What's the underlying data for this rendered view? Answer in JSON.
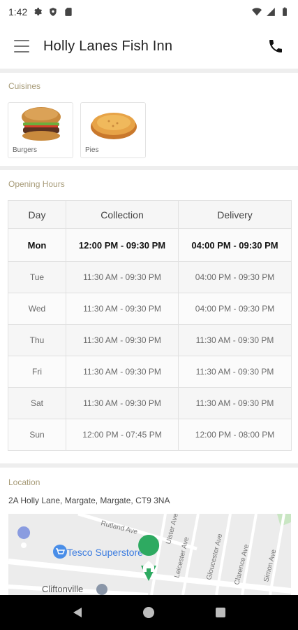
{
  "status_bar": {
    "time": "1:42",
    "icons": [
      "gear-icon",
      "shield-icon",
      "sd-card-icon",
      "wifi-icon",
      "signal-icon",
      "battery-icon"
    ]
  },
  "app_bar": {
    "title": "Holly Lanes Fish Inn",
    "menu_icon": "hamburger-menu-icon",
    "call_icon": "phone-icon"
  },
  "cuisines": {
    "title": "Cuisines",
    "items": [
      {
        "label": "Burgers",
        "icon": "burger-image"
      },
      {
        "label": "Pies",
        "icon": "pie-image"
      }
    ]
  },
  "opening_hours": {
    "title": "Opening Hours",
    "headers": [
      "Day",
      "Collection",
      "Delivery"
    ],
    "rows": [
      {
        "day": "Mon",
        "collection": "12:00 PM - 09:30 PM",
        "delivery": "04:00 PM - 09:30 PM",
        "today": true
      },
      {
        "day": "Tue",
        "collection": "11:30 AM - 09:30 PM",
        "delivery": "04:00 PM - 09:30 PM"
      },
      {
        "day": "Wed",
        "collection": "11:30 AM - 09:30 PM",
        "delivery": "04:00 PM - 09:30 PM"
      },
      {
        "day": "Thu",
        "collection": "11:30 AM - 09:30 PM",
        "delivery": "11:30 AM - 09:30 PM"
      },
      {
        "day": "Fri",
        "collection": "11:30 AM - 09:30 PM",
        "delivery": "11:30 AM - 09:30 PM"
      },
      {
        "day": "Sat",
        "collection": "11:30 AM - 09:30 PM",
        "delivery": "11:30 AM - 09:30 PM"
      },
      {
        "day": "Sun",
        "collection": "12:00 PM - 07:45 PM",
        "delivery": "12:00 PM - 08:00 PM"
      }
    ]
  },
  "location": {
    "title": "Location",
    "address": "2A Holly Lane, Margate, Margate, CT9 3NA",
    "map": {
      "streets": [
        "Rutland Ave",
        "Leicester Ave",
        "Gloucester Ave",
        "Clarence Ave",
        "Simon Ave",
        "Ulster Ave"
      ],
      "places": [
        "Tesco Superstore",
        "Cliftonville"
      ]
    }
  },
  "nav_bar": {
    "back": "back-icon",
    "home": "home-icon",
    "recents": "recents-icon"
  },
  "colors": {
    "section_title": "#a79b78",
    "divider": "#eeeeee",
    "map_pin": "#2eaa61",
    "map_place": "#4a8ee8"
  }
}
